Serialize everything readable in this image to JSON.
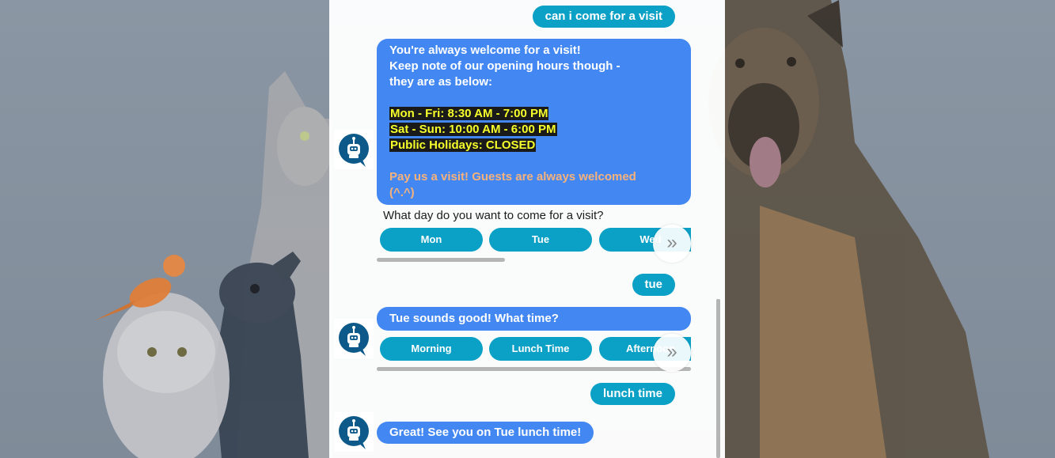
{
  "colors": {
    "user_bubble": "#0ba0c6",
    "bot_bubble": "#4388f2",
    "highlight_bg": "#1a1a1a",
    "highlight_text": "#f6ff2a",
    "accent_orange": "#f7b27c"
  },
  "messages": {
    "user_visit": "can i come for a visit",
    "bot_hours": {
      "lines": [
        "You're always welcome for a visit!",
        "Keep note of our opening hours though -",
        "they are as below:"
      ],
      "hours": [
        "Mon - Fri: 8:30 AM - 7:00 PM",
        "Sat - Sun: 10:00 AM - 6:00 PM",
        "Public Holidays: CLOSED"
      ],
      "closing": [
        "Pay us a visit! Guests are always welcomed",
        "(^.^)"
      ]
    },
    "day_prompt": "What day do you want to come for a visit?",
    "day_options": [
      "Mon",
      "Tue",
      "Wed"
    ],
    "user_day": "tue",
    "bot_time": "Tue sounds good! What time?",
    "time_options": [
      "Morning",
      "Lunch Time",
      "Afternoon"
    ],
    "user_time": "lunch time",
    "bot_confirm": "Great! See you on Tue lunch time!"
  },
  "icons": {
    "avatar": "chatbot-robot-icon",
    "more": "double-chevron-right-icon",
    "more_glyph": "»"
  }
}
